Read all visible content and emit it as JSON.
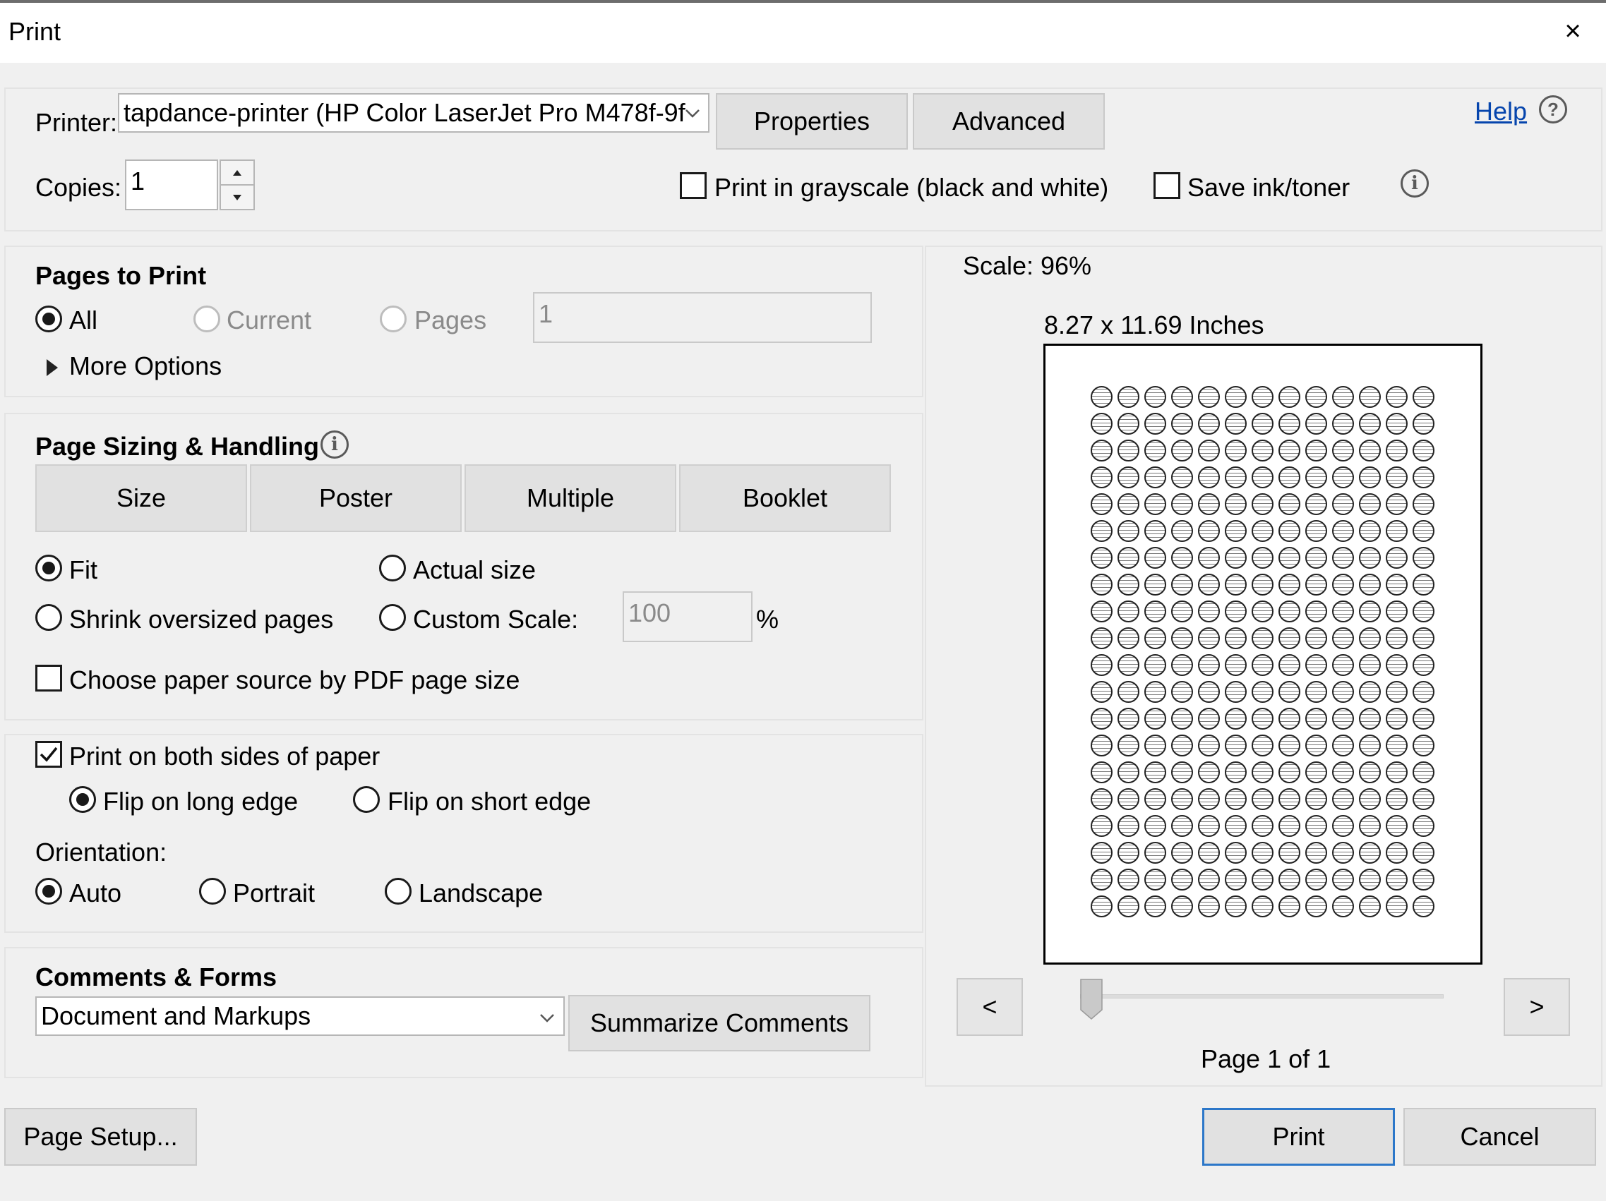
{
  "window": {
    "title": "Print",
    "close_glyph": "×"
  },
  "printer": {
    "label": "Printer:",
    "selected": "tapdance-printer (HP Color LaserJet Pro M478f-9f",
    "properties_label": "Properties",
    "advanced_label": "Advanced",
    "help_label": "Help",
    "help_glyph": "?"
  },
  "copies": {
    "label": "Copies:",
    "value": "1"
  },
  "options": {
    "grayscale_label": "Print in grayscale (black and white)",
    "grayscale_checked": false,
    "save_toner_label": "Save ink/toner",
    "save_toner_checked": false
  },
  "pages_to_print": {
    "heading": "Pages to Print",
    "all_label": "All",
    "current_label": "Current",
    "pages_label": "Pages",
    "pages_value": "1",
    "selected": "All",
    "more_options_label": "More Options"
  },
  "sizing": {
    "heading": "Page Sizing & Handling",
    "tabs": [
      "Size",
      "Poster",
      "Multiple",
      "Booklet"
    ],
    "fit_label": "Fit",
    "actual_label": "Actual size",
    "shrink_label": "Shrink oversized pages",
    "custom_label": "Custom Scale:",
    "custom_value": "100",
    "percent": "%",
    "selected": "Fit",
    "paper_source_label": "Choose paper source by PDF page size",
    "paper_source_checked": false
  },
  "duplex": {
    "both_sides_label": "Print on both sides of paper",
    "both_sides_checked": true,
    "long_edge_label": "Flip on long edge",
    "short_edge_label": "Flip on short edge",
    "selected": "long"
  },
  "orientation": {
    "label": "Orientation:",
    "auto_label": "Auto",
    "portrait_label": "Portrait",
    "landscape_label": "Landscape",
    "selected": "Auto"
  },
  "comments": {
    "heading": "Comments & Forms",
    "selected": "Document and Markups",
    "summarize_label": "Summarize Comments"
  },
  "preview": {
    "scale_label": "Scale:",
    "scale_value": "96%",
    "size_text": "8.27 x 11.69 Inches",
    "prev_label": "<",
    "next_label": ">",
    "page_text": "Page 1 of 1",
    "slider_position": 0
  },
  "footer": {
    "page_setup_label": "Page Setup...",
    "print_label": "Print",
    "cancel_label": "Cancel"
  }
}
